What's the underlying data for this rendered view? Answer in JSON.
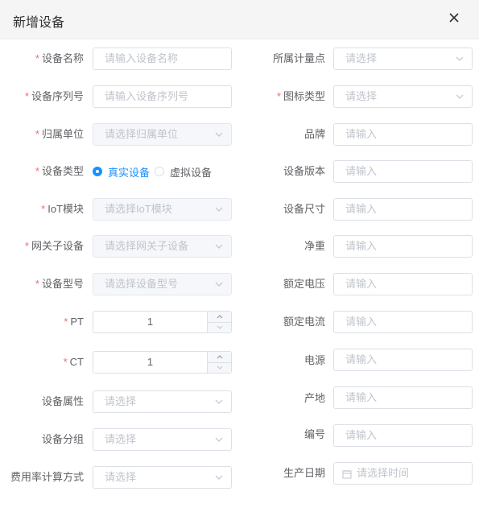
{
  "dialog": {
    "title": "新增设备"
  },
  "left": {
    "device_name": {
      "label": "设备名称",
      "placeholder": "请输入设备名称"
    },
    "device_serial": {
      "label": "设备序列号",
      "placeholder": "请输入设备序列号"
    },
    "owner_unit": {
      "label": "归属单位",
      "placeholder": "请选择归属单位"
    },
    "device_type": {
      "label": "设备类型",
      "options": [
        "真实设备",
        "虚拟设备"
      ],
      "selected": "真实设备"
    },
    "iot_module": {
      "label": "IoT模块",
      "placeholder": "请选择IoT模块"
    },
    "gateway": {
      "label": "网关子设备",
      "placeholder": "请选择网关子设备"
    },
    "model": {
      "label": "设备型号",
      "placeholder": "请选择设备型号"
    },
    "pt": {
      "label": "PT",
      "value": "1"
    },
    "ct": {
      "label": "CT",
      "value": "1"
    },
    "attribute": {
      "label": "设备属性",
      "placeholder": "请选择"
    },
    "group": {
      "label": "设备分组",
      "placeholder": "请选择"
    },
    "rate_method": {
      "label": "费用率计算方式",
      "placeholder": "请选择"
    }
  },
  "right": {
    "metering_point": {
      "label": "所属计量点",
      "placeholder": "请选择"
    },
    "icon_type": {
      "label": "图标类型",
      "placeholder": "请选择"
    },
    "brand": {
      "label": "品牌",
      "placeholder": "请输入"
    },
    "version": {
      "label": "设备版本",
      "placeholder": "请输入"
    },
    "size": {
      "label": "设备尺寸",
      "placeholder": "请输入"
    },
    "net_weight": {
      "label": "净重",
      "placeholder": "请输入"
    },
    "rated_voltage": {
      "label": "额定电压",
      "placeholder": "请输入"
    },
    "rated_current": {
      "label": "额定电流",
      "placeholder": "请输入"
    },
    "power": {
      "label": "电源",
      "placeholder": "请输入"
    },
    "origin": {
      "label": "产地",
      "placeholder": "请输入"
    },
    "serial_no": {
      "label": "编号",
      "placeholder": "请输入"
    },
    "production_date": {
      "label": "生产日期",
      "placeholder": "请选择时间"
    }
  },
  "colors": {
    "accent": "#1890ff",
    "required": "#f56c6c",
    "border": "#dcdfe6",
    "placeholder": "#c0c4cc"
  },
  "icons": [
    "close-icon",
    "chevron-down-icon",
    "chevron-up-icon",
    "calendar-icon"
  ]
}
